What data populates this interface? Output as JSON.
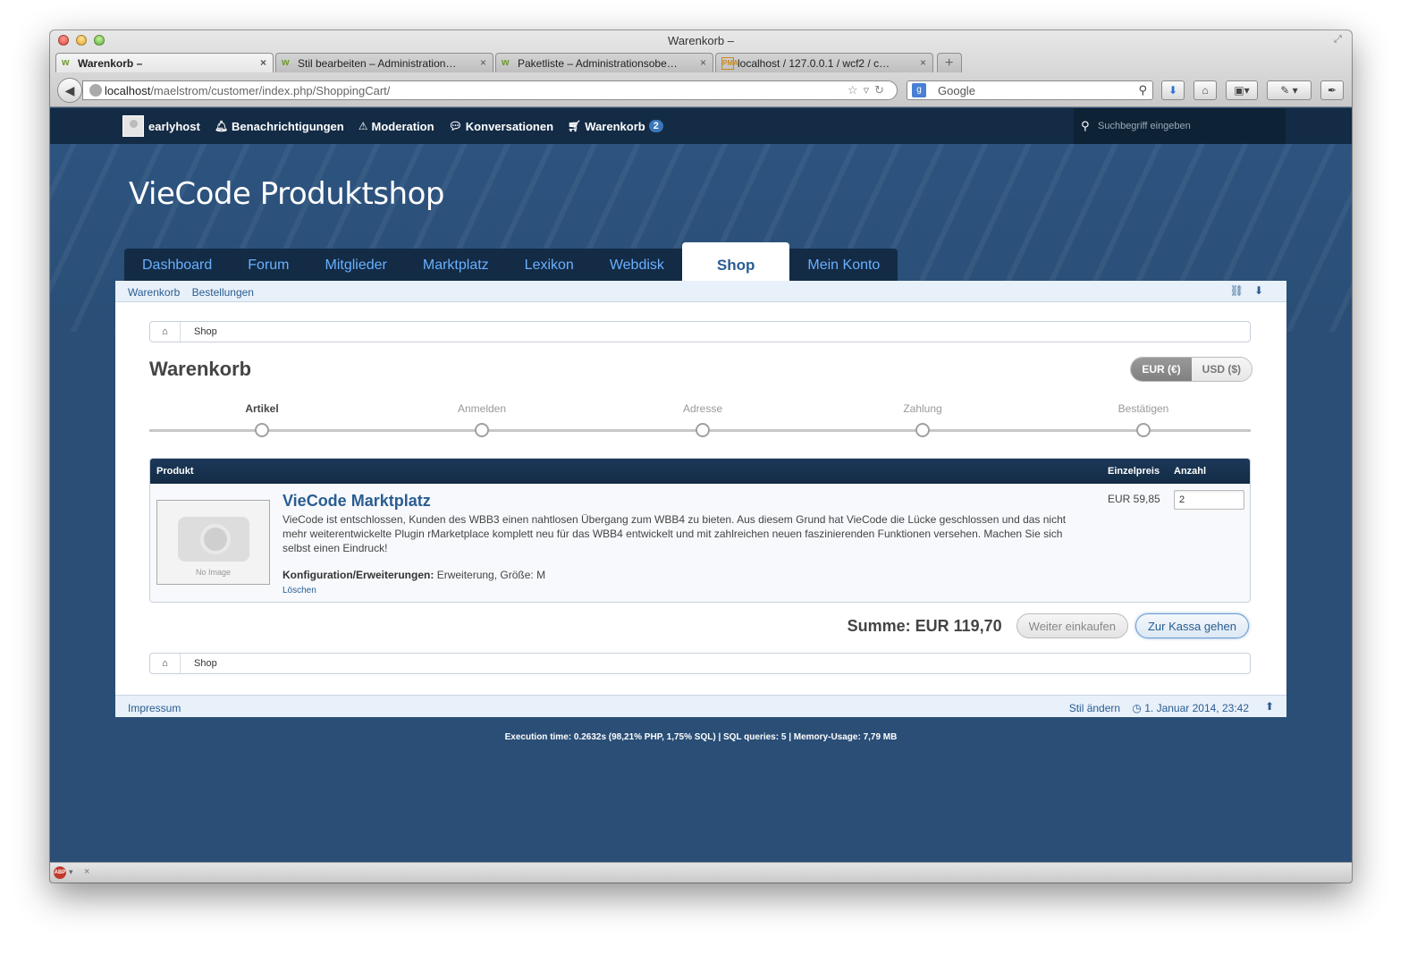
{
  "window": {
    "title": "Warenkorb –"
  },
  "tabs": [
    {
      "label": "Warenkorb –",
      "active": true
    },
    {
      "label": "Stil bearbeiten – Administration…",
      "active": false
    },
    {
      "label": "Paketliste – Administrationsobe…",
      "active": false
    },
    {
      "label": "localhost / 127.0.0.1 / wcf2 / c…",
      "active": false
    }
  ],
  "toolbar": {
    "url_host": "localhost",
    "url_path": "/maelstrom/customer/index.php/ShoppingCart/",
    "search_placeholder": "Google"
  },
  "userbar": {
    "username": "earlyhost",
    "notifications": "Benachrichtigungen",
    "moderation": "Moderation",
    "conversations": "Konversationen",
    "cart": "Warenkorb",
    "cart_count": "2",
    "search_placeholder": "Suchbegriff eingeben"
  },
  "logo": "VieCode Produktshop",
  "mainnav": [
    {
      "label": "Dashboard",
      "active": false
    },
    {
      "label": "Forum",
      "active": false
    },
    {
      "label": "Mitglieder",
      "active": false
    },
    {
      "label": "Marktplatz",
      "active": false
    },
    {
      "label": "Lexikon",
      "active": false
    },
    {
      "label": "Webdisk",
      "active": false
    },
    {
      "label": "Shop",
      "active": true
    },
    {
      "label": "Mein Konto",
      "active": false
    }
  ],
  "subnav": {
    "cart": "Warenkorb",
    "orders": "Bestellungen"
  },
  "breadcrumb": {
    "item": "Shop"
  },
  "page": {
    "title": "Warenkorb"
  },
  "currency": {
    "eur": "EUR (€)",
    "usd": "USD ($)",
    "selected": "eur"
  },
  "steps": [
    {
      "label": "Artikel",
      "current": true
    },
    {
      "label": "Anmelden",
      "current": false
    },
    {
      "label": "Adresse",
      "current": false
    },
    {
      "label": "Zahlung",
      "current": false
    },
    {
      "label": "Bestätigen",
      "current": false
    }
  ],
  "cart": {
    "headers": {
      "product": "Produkt",
      "price": "Einzelpreis",
      "quantity": "Anzahl"
    },
    "item": {
      "no_image": "No Image",
      "title": "VieCode Marktplatz",
      "description": "VieCode ist entschlossen, Kunden des WBB3 einen nahtlosen Übergang zum WBB4 zu bieten. Aus diesem Grund hat VieCode die Lücke geschlossen und das nicht mehr weiterentwickelte Plugin rMarketplace komplett neu für das WBB4 entwickelt und mit zahlreichen neuen faszinierenden Funktionen versehen. Machen Sie sich selbst einen Eindruck!",
      "config_label": "Konfiguration/Erweiterungen:",
      "config_value": "Erweiterung, Größe: M",
      "delete": "Löschen",
      "price": "EUR 59,85",
      "quantity": "2"
    },
    "sum": "Summe: EUR 119,70",
    "continue_shopping": "Weiter einkaufen",
    "checkout": "Zur Kassa gehen"
  },
  "footer": {
    "imprint": "Impressum",
    "change_style": "Stil ändern",
    "datetime": "1. Januar 2014, 23:42"
  },
  "exec_info": "Execution time: 0.2632s (98,21% PHP, 1,75% SQL) | SQL queries: 5 | Memory-Usage: 7,79 MB"
}
